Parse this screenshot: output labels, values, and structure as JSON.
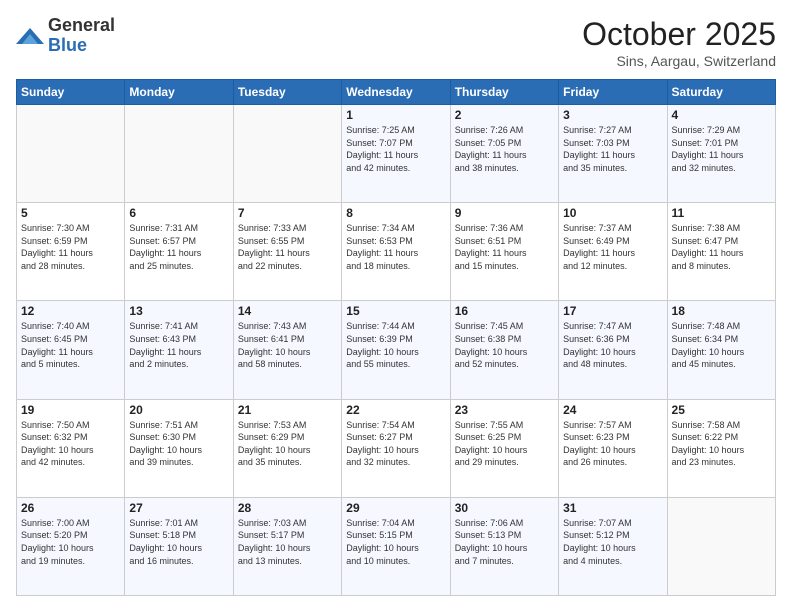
{
  "logo": {
    "general": "General",
    "blue": "Blue"
  },
  "header": {
    "month": "October 2025",
    "location": "Sins, Aargau, Switzerland"
  },
  "weekdays": [
    "Sunday",
    "Monday",
    "Tuesday",
    "Wednesday",
    "Thursday",
    "Friday",
    "Saturday"
  ],
  "weeks": [
    [
      {
        "day": "",
        "info": ""
      },
      {
        "day": "",
        "info": ""
      },
      {
        "day": "",
        "info": ""
      },
      {
        "day": "1",
        "info": "Sunrise: 7:25 AM\nSunset: 7:07 PM\nDaylight: 11 hours\nand 42 minutes."
      },
      {
        "day": "2",
        "info": "Sunrise: 7:26 AM\nSunset: 7:05 PM\nDaylight: 11 hours\nand 38 minutes."
      },
      {
        "day": "3",
        "info": "Sunrise: 7:27 AM\nSunset: 7:03 PM\nDaylight: 11 hours\nand 35 minutes."
      },
      {
        "day": "4",
        "info": "Sunrise: 7:29 AM\nSunset: 7:01 PM\nDaylight: 11 hours\nand 32 minutes."
      }
    ],
    [
      {
        "day": "5",
        "info": "Sunrise: 7:30 AM\nSunset: 6:59 PM\nDaylight: 11 hours\nand 28 minutes."
      },
      {
        "day": "6",
        "info": "Sunrise: 7:31 AM\nSunset: 6:57 PM\nDaylight: 11 hours\nand 25 minutes."
      },
      {
        "day": "7",
        "info": "Sunrise: 7:33 AM\nSunset: 6:55 PM\nDaylight: 11 hours\nand 22 minutes."
      },
      {
        "day": "8",
        "info": "Sunrise: 7:34 AM\nSunset: 6:53 PM\nDaylight: 11 hours\nand 18 minutes."
      },
      {
        "day": "9",
        "info": "Sunrise: 7:36 AM\nSunset: 6:51 PM\nDaylight: 11 hours\nand 15 minutes."
      },
      {
        "day": "10",
        "info": "Sunrise: 7:37 AM\nSunset: 6:49 PM\nDaylight: 11 hours\nand 12 minutes."
      },
      {
        "day": "11",
        "info": "Sunrise: 7:38 AM\nSunset: 6:47 PM\nDaylight: 11 hours\nand 8 minutes."
      }
    ],
    [
      {
        "day": "12",
        "info": "Sunrise: 7:40 AM\nSunset: 6:45 PM\nDaylight: 11 hours\nand 5 minutes."
      },
      {
        "day": "13",
        "info": "Sunrise: 7:41 AM\nSunset: 6:43 PM\nDaylight: 11 hours\nand 2 minutes."
      },
      {
        "day": "14",
        "info": "Sunrise: 7:43 AM\nSunset: 6:41 PM\nDaylight: 10 hours\nand 58 minutes."
      },
      {
        "day": "15",
        "info": "Sunrise: 7:44 AM\nSunset: 6:39 PM\nDaylight: 10 hours\nand 55 minutes."
      },
      {
        "day": "16",
        "info": "Sunrise: 7:45 AM\nSunset: 6:38 PM\nDaylight: 10 hours\nand 52 minutes."
      },
      {
        "day": "17",
        "info": "Sunrise: 7:47 AM\nSunset: 6:36 PM\nDaylight: 10 hours\nand 48 minutes."
      },
      {
        "day": "18",
        "info": "Sunrise: 7:48 AM\nSunset: 6:34 PM\nDaylight: 10 hours\nand 45 minutes."
      }
    ],
    [
      {
        "day": "19",
        "info": "Sunrise: 7:50 AM\nSunset: 6:32 PM\nDaylight: 10 hours\nand 42 minutes."
      },
      {
        "day": "20",
        "info": "Sunrise: 7:51 AM\nSunset: 6:30 PM\nDaylight: 10 hours\nand 39 minutes."
      },
      {
        "day": "21",
        "info": "Sunrise: 7:53 AM\nSunset: 6:29 PM\nDaylight: 10 hours\nand 35 minutes."
      },
      {
        "day": "22",
        "info": "Sunrise: 7:54 AM\nSunset: 6:27 PM\nDaylight: 10 hours\nand 32 minutes."
      },
      {
        "day": "23",
        "info": "Sunrise: 7:55 AM\nSunset: 6:25 PM\nDaylight: 10 hours\nand 29 minutes."
      },
      {
        "day": "24",
        "info": "Sunrise: 7:57 AM\nSunset: 6:23 PM\nDaylight: 10 hours\nand 26 minutes."
      },
      {
        "day": "25",
        "info": "Sunrise: 7:58 AM\nSunset: 6:22 PM\nDaylight: 10 hours\nand 23 minutes."
      }
    ],
    [
      {
        "day": "26",
        "info": "Sunrise: 7:00 AM\nSunset: 5:20 PM\nDaylight: 10 hours\nand 19 minutes."
      },
      {
        "day": "27",
        "info": "Sunrise: 7:01 AM\nSunset: 5:18 PM\nDaylight: 10 hours\nand 16 minutes."
      },
      {
        "day": "28",
        "info": "Sunrise: 7:03 AM\nSunset: 5:17 PM\nDaylight: 10 hours\nand 13 minutes."
      },
      {
        "day": "29",
        "info": "Sunrise: 7:04 AM\nSunset: 5:15 PM\nDaylight: 10 hours\nand 10 minutes."
      },
      {
        "day": "30",
        "info": "Sunrise: 7:06 AM\nSunset: 5:13 PM\nDaylight: 10 hours\nand 7 minutes."
      },
      {
        "day": "31",
        "info": "Sunrise: 7:07 AM\nSunset: 5:12 PM\nDaylight: 10 hours\nand 4 minutes."
      },
      {
        "day": "",
        "info": ""
      }
    ]
  ]
}
